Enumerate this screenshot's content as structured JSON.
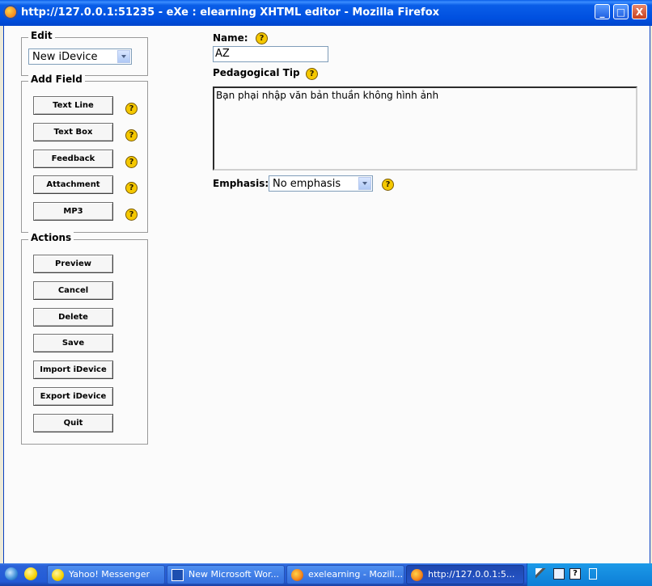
{
  "window": {
    "title": "http://127.0.0.1:51235 - eXe : elearning XHTML editor - Mozilla Firefox",
    "controls": {
      "minimize": "_",
      "maximize": "□",
      "close": "X"
    }
  },
  "edit": {
    "legend": "Edit",
    "selected": "New iDevice"
  },
  "add_field": {
    "legend": "Add Field",
    "buttons": [
      "Text Line",
      "Text Box",
      "Feedback",
      "Attachment",
      "MP3"
    ],
    "help": "?"
  },
  "actions": {
    "legend": "Actions",
    "buttons": [
      "Preview",
      "Cancel",
      "Delete",
      "Save",
      "Import iDevice",
      "Export iDevice",
      "Quit"
    ]
  },
  "form": {
    "name_label": "Name:",
    "name_value": "AZ",
    "tip_label": "Pedagogical Tip",
    "tip_value": "Bạn phại nhập văn bản thuần không hình ảnh",
    "emphasis_label": "Emphasis:",
    "emphasis_selected": "No emphasis",
    "help": "?"
  },
  "taskbar": {
    "buttons": [
      {
        "label": "Yahoo! Messenger",
        "icon": "yahoo-messenger-icon"
      },
      {
        "label": "New Microsoft Wor...",
        "icon": "word-document-icon"
      },
      {
        "label": "exelearning - Mozill...",
        "icon": "firefox-icon"
      },
      {
        "label": "http://127.0.0.1:5...",
        "icon": "firefox-icon"
      }
    ],
    "quicklaunch": [
      "ie-icon",
      "yahoo-icon"
    ],
    "tray": [
      "pen-icon",
      "monitor-icon",
      "help-icon",
      "restore-icon"
    ]
  }
}
